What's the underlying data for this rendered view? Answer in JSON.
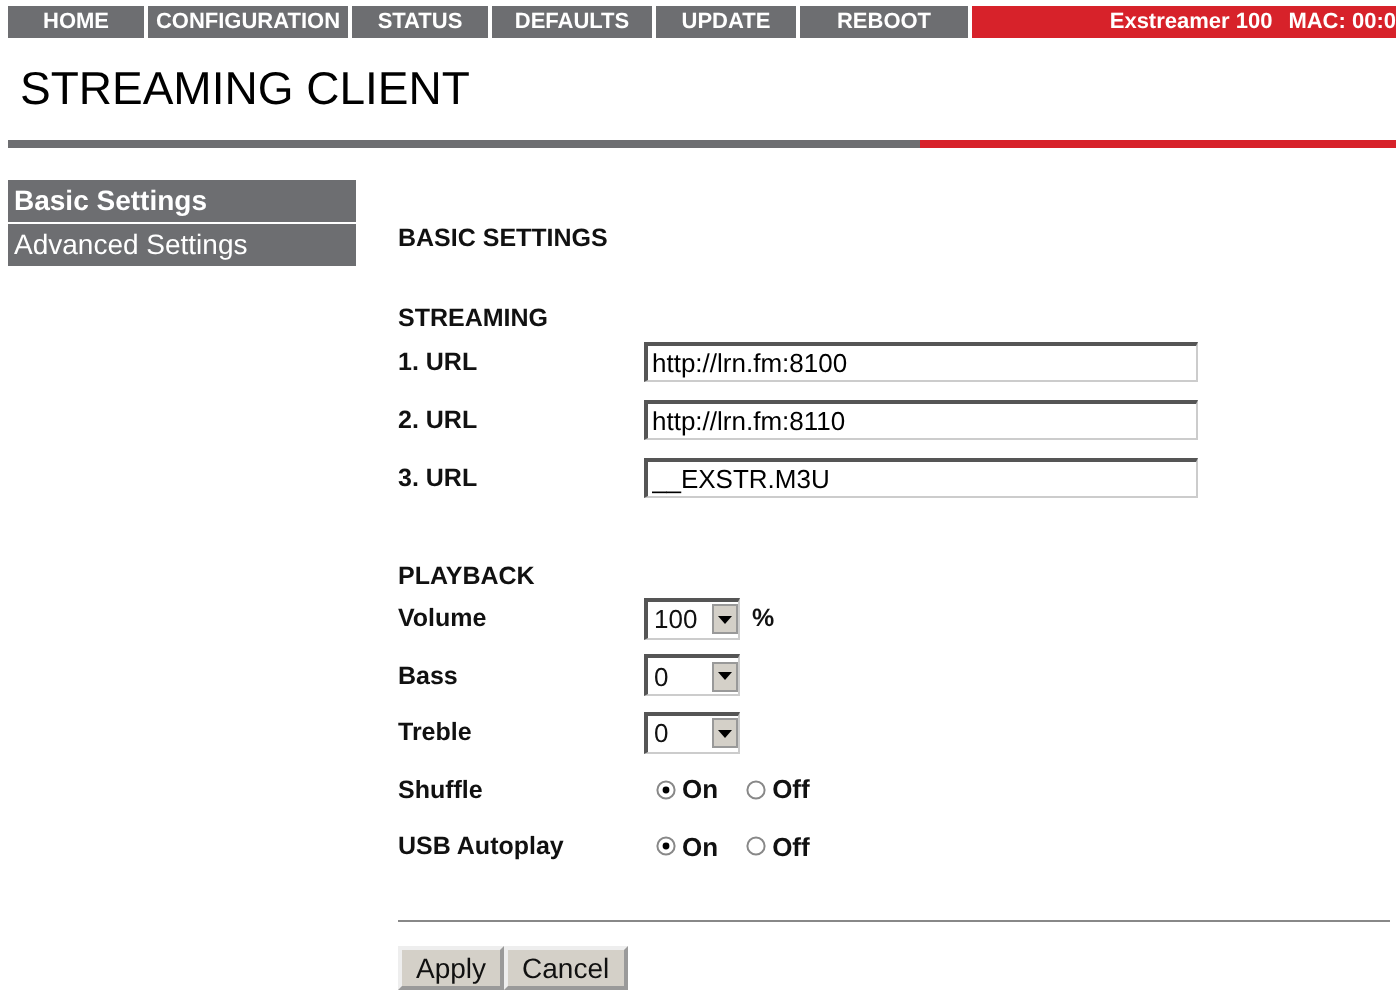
{
  "nav": {
    "items": [
      "HOME",
      "CONFIGURATION",
      "STATUS",
      "DEFAULTS",
      "UPDATE",
      "REBOOT"
    ],
    "device": "Exstreamer 100",
    "mac": "MAC: 00:0"
  },
  "title": "STREAMING CLIENT",
  "sidebar": {
    "items": [
      {
        "label": "Basic Settings",
        "selected": true
      },
      {
        "label": "Advanced Settings",
        "selected": false
      }
    ]
  },
  "page_heading": "BASIC SETTINGS",
  "streaming": {
    "heading": "STREAMING",
    "urls": [
      {
        "label": "1. URL",
        "value": "http://lrn.fm:8100"
      },
      {
        "label": "2. URL",
        "value": "http://lrn.fm:8110"
      },
      {
        "label": "3. URL",
        "value": "__EXSTR.M3U"
      }
    ]
  },
  "playback": {
    "heading": "PLAYBACK",
    "rows": [
      {
        "kind": "select",
        "label": "Volume",
        "value": "100",
        "unit": "%"
      },
      {
        "kind": "select",
        "label": "Bass",
        "value": "0"
      },
      {
        "kind": "select",
        "label": "Treble",
        "value": "0"
      },
      {
        "kind": "radio",
        "label": "Shuffle",
        "options": [
          {
            "label": "On",
            "selected": true
          },
          {
            "label": "Off",
            "selected": false
          }
        ]
      },
      {
        "kind": "radio",
        "label": "USB Autoplay",
        "options": [
          {
            "label": "On",
            "selected": true
          },
          {
            "label": "Off",
            "selected": false
          }
        ]
      }
    ]
  },
  "buttons": [
    "Apply",
    "Cancel"
  ]
}
